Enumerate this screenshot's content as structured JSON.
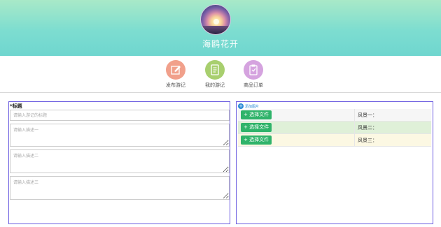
{
  "header": {
    "username": "海鸥花开"
  },
  "nav": {
    "items": [
      {
        "label": "发布游记",
        "icon": "edit-icon",
        "color": "#f1a08b"
      },
      {
        "label": "我的游记",
        "icon": "notebook-icon",
        "color": "#a8cf6e"
      },
      {
        "label": "商品订单",
        "icon": "clipboard-icon",
        "color": "#d5a3df"
      }
    ]
  },
  "form": {
    "title_label": "*标题",
    "title_placeholder": "请输入游记的标题",
    "desc1_placeholder": "请输入描述一",
    "desc2_placeholder": "请输入描述二",
    "desc3_placeholder": "请输入描述三"
  },
  "images": {
    "add_label": "添加图片",
    "rows": [
      {
        "button": "+ 选择文件",
        "label": "风景一："
      },
      {
        "button": "+ 选择文件",
        "label": "风景二："
      },
      {
        "button": "+ 选择文件",
        "label": "风景三："
      }
    ]
  },
  "colors": {
    "panel_border": "#6b5ce0",
    "file_button": "#2fb36a",
    "banner_top": "#a9e9c8",
    "banner_bottom": "#6fd6cf"
  }
}
